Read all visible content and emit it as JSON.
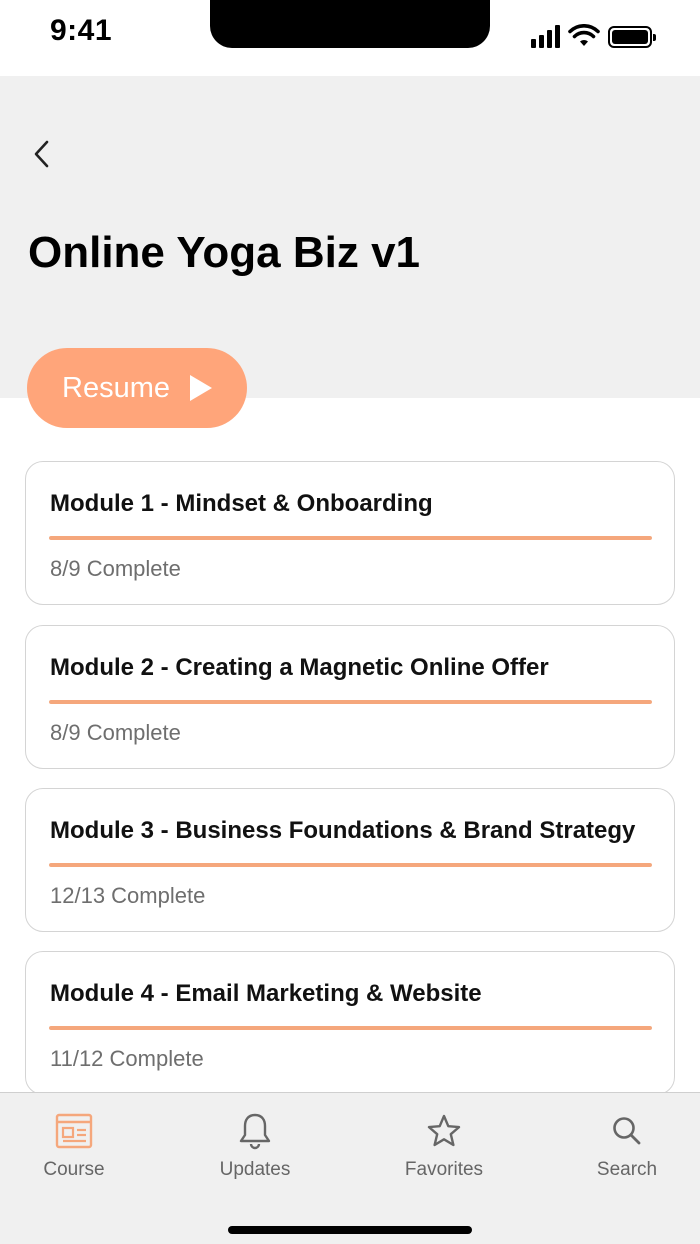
{
  "status_bar": {
    "time": "9:41"
  },
  "header": {
    "title": "Online Yoga Biz v1",
    "back_icon": "chevron-left-icon"
  },
  "resume": {
    "label": "Resume",
    "icon": "play-icon"
  },
  "modules": [
    {
      "title": "Module 1 - Mindset & Onboarding",
      "status": "8/9 Complete",
      "progress": 1.0
    },
    {
      "title": "Module 2 - Creating a Magnetic Online Offer",
      "status": "8/9 Complete",
      "progress": 1.0
    },
    {
      "title": "Module 3 - Business Foundations & Brand Strategy",
      "status": "12/13 Complete",
      "progress": 1.0
    },
    {
      "title": "Module 4 - Email Marketing & Website",
      "status": "11/12 Complete",
      "progress": 1.0
    }
  ],
  "tabs": [
    {
      "label": "Course",
      "icon": "course-icon",
      "active": true
    },
    {
      "label": "Updates",
      "icon": "bell-icon",
      "active": false
    },
    {
      "label": "Favorites",
      "icon": "star-icon",
      "active": false
    },
    {
      "label": "Search",
      "icon": "search-icon",
      "active": false
    }
  ],
  "colors": {
    "accent": "#ffa57a",
    "progress": "#f5a77c",
    "header_bg": "#f0f0f0",
    "active_tab": "#f5a77c",
    "inactive_tab": "#666666"
  }
}
